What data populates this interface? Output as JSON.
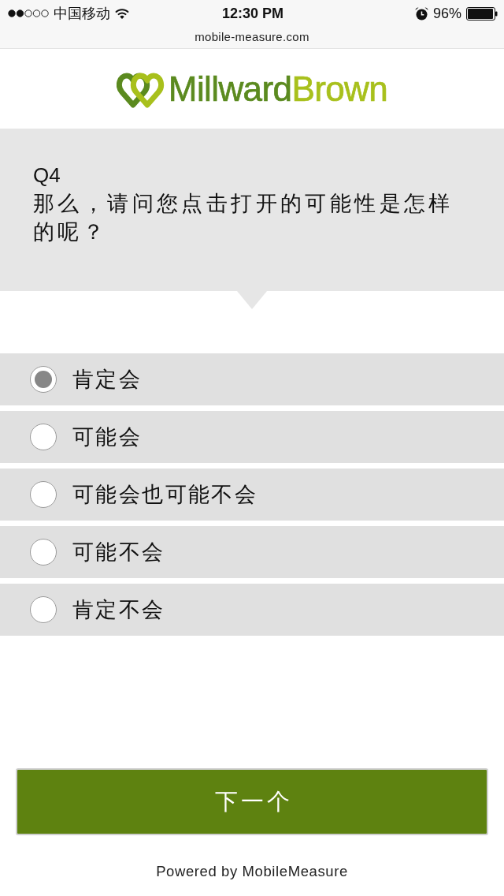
{
  "status_bar": {
    "carrier": "中国移动",
    "time": "12:30 PM",
    "battery": "96%"
  },
  "address_bar": {
    "url": "mobile-measure.com"
  },
  "logo": {
    "words": [
      {
        "text": "Millward",
        "color": "#5b8a1f"
      },
      {
        "text": "Brown",
        "color": "#a8c01c"
      }
    ]
  },
  "question": {
    "number": "Q4",
    "text": "那么，请问您点击打开的可能性是怎样的呢？"
  },
  "options": [
    {
      "label": "肯定会",
      "selected": true
    },
    {
      "label": "可能会",
      "selected": false
    },
    {
      "label": "可能会也可能不会",
      "selected": false
    },
    {
      "label": "可能不会",
      "selected": false
    },
    {
      "label": "肯定不会",
      "selected": false
    }
  ],
  "next_button": {
    "label": "下一个"
  },
  "footer": {
    "text": "Powered by MobileMeasure"
  }
}
